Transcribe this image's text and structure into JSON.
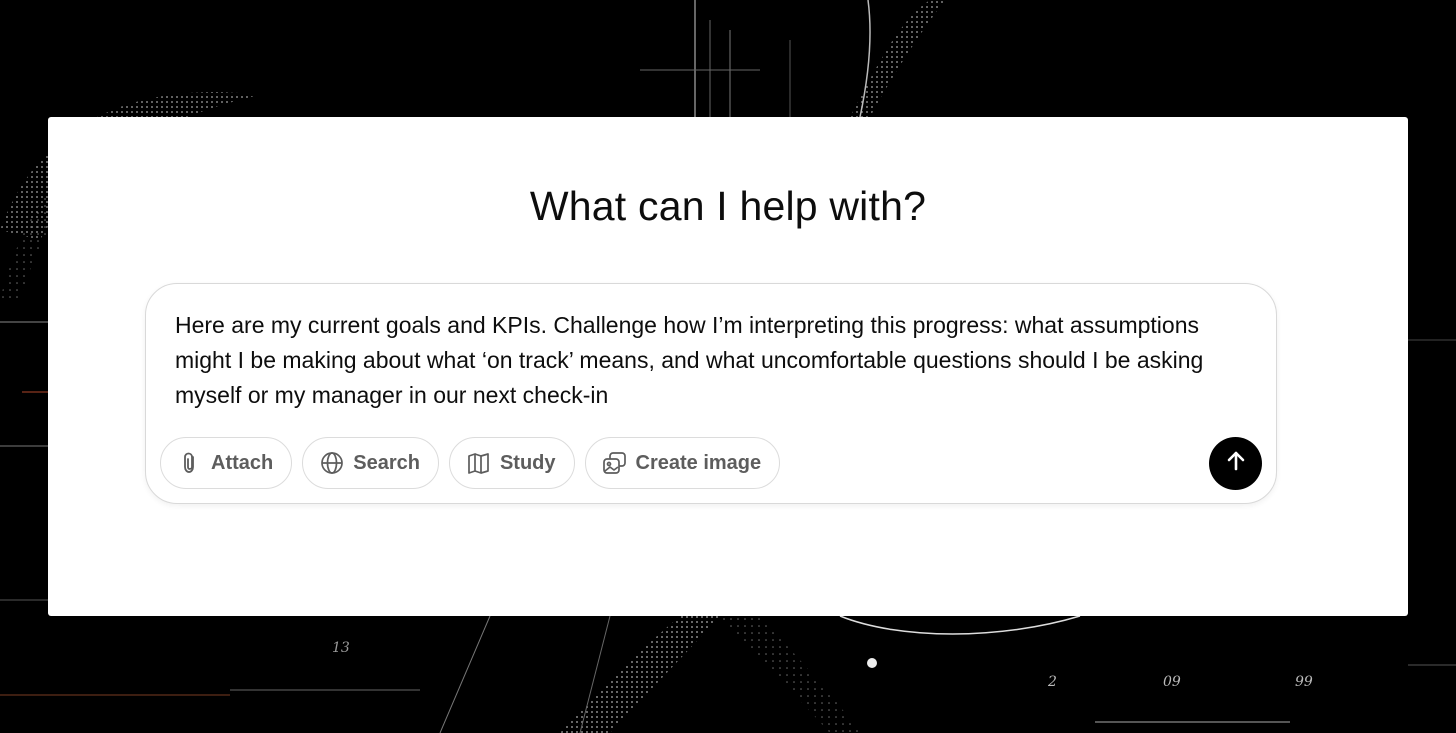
{
  "headline": "What can I help with?",
  "composer": {
    "value": "Here are my current goals and KPIs. Challenge how I’m interpreting this progress: what assumptions might I be making about what ‘on track’ means, and what uncomfortable questions should I be asking myself or my manager in our next check-in"
  },
  "tools": [
    {
      "label": "Attach",
      "icon": "paperclip-icon"
    },
    {
      "label": "Search",
      "icon": "globe-icon"
    },
    {
      "label": "Study",
      "icon": "book-icon"
    },
    {
      "label": "Create image",
      "icon": "image-icon"
    }
  ],
  "send": {
    "icon": "arrow-up-icon"
  },
  "background": {
    "numerals": [
      "2",
      "09",
      "99",
      "13"
    ]
  },
  "colors": {
    "background": "#000000",
    "card": "#ffffff",
    "text": "#0d0d0d",
    "tool_text": "#5d5d5d",
    "send_button": "#000000"
  }
}
